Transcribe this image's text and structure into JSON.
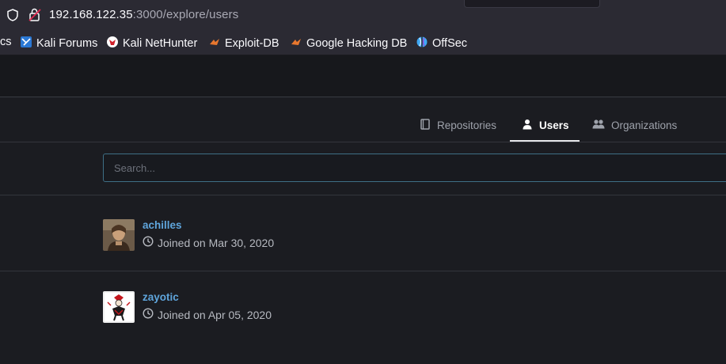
{
  "browser": {
    "url_host": "192.168.122.35",
    "url_rest": ":3000/explore/users"
  },
  "bookmarks": [
    {
      "label": "cs",
      "icon": "truncated"
    },
    {
      "label": "Kali Forums",
      "icon": "kali-forums-icon"
    },
    {
      "label": "Kali NetHunter",
      "icon": "kali-nethunter-icon"
    },
    {
      "label": "Exploit-DB",
      "icon": "exploit-db-icon"
    },
    {
      "label": "Google Hacking DB",
      "icon": "ghdb-icon"
    },
    {
      "label": "OffSec",
      "icon": "offsec-icon"
    }
  ],
  "tabs": [
    {
      "label": "Repositories",
      "icon": "book-icon",
      "active": false
    },
    {
      "label": "Users",
      "icon": "person-icon",
      "active": true
    },
    {
      "label": "Organizations",
      "icon": "people-icon",
      "active": false
    }
  ],
  "search": {
    "placeholder": "Search...",
    "value": ""
  },
  "users": [
    {
      "name": "achilles",
      "joined": "Joined on Mar 30, 2020"
    },
    {
      "name": "zayotic",
      "joined": "Joined on Apr 05, 2020"
    }
  ],
  "colors": {
    "accent_link": "#5fa5dc",
    "search_border": "#3e6f86",
    "background": "#1b1c21"
  }
}
